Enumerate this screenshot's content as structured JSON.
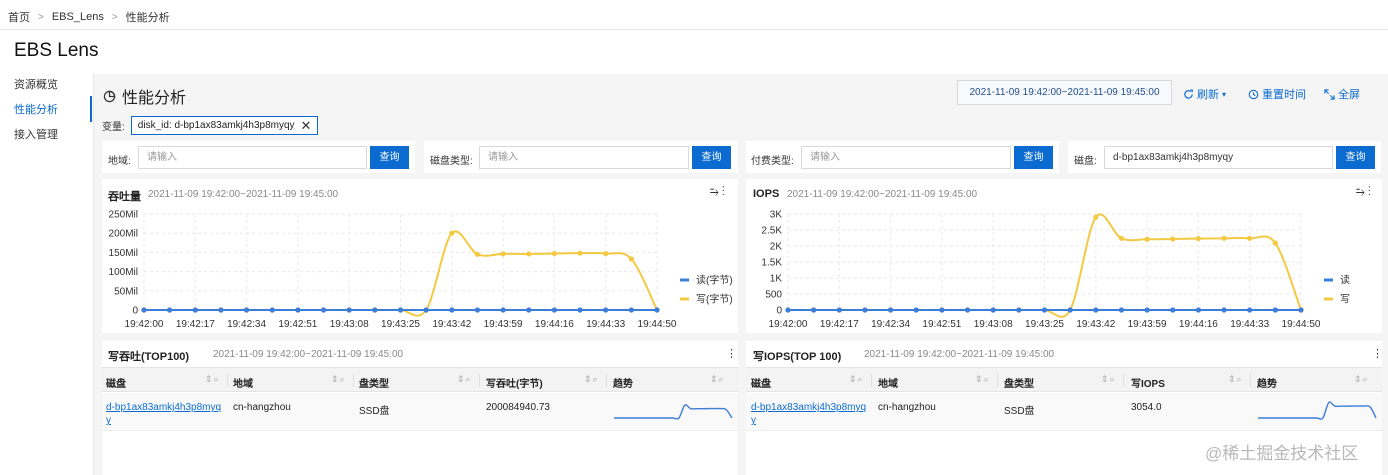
{
  "breadcrumb": {
    "home": "首页",
    "app": "EBS_Lens",
    "current": "性能分析"
  },
  "app_title": "EBS Lens",
  "sidebar": {
    "items": [
      {
        "label": "资源概览",
        "active": false
      },
      {
        "label": "性能分析",
        "active": true
      },
      {
        "label": "接入管理",
        "active": false
      }
    ]
  },
  "page": {
    "title": "性能分析",
    "time_range": "2021-11-09 19:42:00~2021-11-09 19:45:00",
    "refresh": "刷新",
    "reset": "重置时间",
    "fullscreen": "全屏"
  },
  "variables": {
    "label": "变量:",
    "tag": "disk_id: d-bp1ax83amkj4h3p8myqy"
  },
  "filters": [
    {
      "label": "地域:",
      "placeholder": "请输入",
      "value": "",
      "button": "查询"
    },
    {
      "label": "磁盘类型:",
      "placeholder": "请输入",
      "value": "",
      "button": "查询"
    },
    {
      "label": "付费类型:",
      "placeholder": "请输入",
      "value": "",
      "button": "查询"
    },
    {
      "label": "磁盘:",
      "placeholder": "",
      "value": "d-bp1ax83amkj4h3p8myqy",
      "button": "查询"
    }
  ],
  "colors": {
    "accent": "#0b6bd1",
    "read": "#3b7dd8",
    "write": "#f4c942"
  },
  "chart_data": [
    {
      "type": "line",
      "title": "吞吐量",
      "subtitle": "2021-11-09 19:42:00~2021-11-09 19:45:00",
      "x": [
        "19:42:00",
        "19:42:08",
        "19:42:17",
        "19:42:25",
        "19:42:34",
        "19:42:42",
        "19:42:51",
        "19:42:59",
        "19:43:08",
        "19:43:16",
        "19:43:25",
        "19:43:33",
        "19:43:42",
        "19:43:50",
        "19:43:59",
        "19:44:07",
        "19:44:16",
        "19:44:24",
        "19:44:33",
        "19:44:41",
        "19:44:50"
      ],
      "xticks": [
        "19:42:00",
        "19:42:17",
        "19:42:34",
        "19:42:51",
        "19:43:08",
        "19:43:25",
        "19:43:42",
        "19:43:59",
        "19:44:16",
        "19:44:33",
        "19:44:50"
      ],
      "yticks": [
        "0",
        "50Mil",
        "100Mil",
        "150Mil",
        "200Mil",
        "250Mil"
      ],
      "ylim": [
        0,
        250
      ],
      "legend_position": "right",
      "series": [
        {
          "name": "读(字节)",
          "values": [
            0,
            0,
            0,
            0,
            0,
            0,
            0,
            0,
            0,
            0,
            0,
            0,
            0,
            0,
            0,
            0,
            0,
            0,
            0,
            0,
            0
          ]
        },
        {
          "name": "写(字节)",
          "values": [
            0,
            0,
            0,
            0,
            0,
            0,
            0,
            0,
            0,
            0,
            0,
            0,
            200,
            145,
            146,
            146,
            147,
            148,
            147,
            133,
            0
          ]
        }
      ]
    },
    {
      "type": "line",
      "title": "IOPS",
      "subtitle": "2021-11-09 19:42:00~2021-11-09 19:45:00",
      "x": [
        "19:42:00",
        "19:42:08",
        "19:42:17",
        "19:42:25",
        "19:42:34",
        "19:42:42",
        "19:42:51",
        "19:42:59",
        "19:43:08",
        "19:43:16",
        "19:43:25",
        "19:43:33",
        "19:43:42",
        "19:43:50",
        "19:43:59",
        "19:44:07",
        "19:44:16",
        "19:44:24",
        "19:44:33",
        "19:44:41",
        "19:44:50"
      ],
      "xticks": [
        "19:42:00",
        "19:42:17",
        "19:42:34",
        "19:42:51",
        "19:43:08",
        "19:43:25",
        "19:43:42",
        "19:43:59",
        "19:44:16",
        "19:44:33",
        "19:44:50"
      ],
      "yticks": [
        "0",
        "500",
        "1K",
        "1.5K",
        "2K",
        "2.5K",
        "3K"
      ],
      "ylim": [
        0,
        3000
      ],
      "legend_position": "right",
      "series": [
        {
          "name": "读",
          "values": [
            0,
            0,
            0,
            0,
            0,
            0,
            0,
            0,
            0,
            0,
            0,
            0,
            0,
            0,
            0,
            0,
            0,
            0,
            0,
            0,
            0
          ]
        },
        {
          "name": "写",
          "values": [
            0,
            0,
            0,
            0,
            0,
            0,
            0,
            0,
            0,
            0,
            0,
            0,
            2900,
            2240,
            2210,
            2220,
            2230,
            2240,
            2240,
            2090,
            0
          ]
        }
      ]
    }
  ],
  "tables": [
    {
      "title": "写吞吐(TOP100)",
      "subtitle": "2021-11-09 19:42:00~2021-11-09 19:45:00",
      "columns": [
        "磁盘",
        "地域",
        "盘类型",
        "写吞吐(字节)",
        "趋势"
      ],
      "rows": [
        {
          "disk": "d-bp1ax83amkj4h3p8myqy",
          "disk_line1": "d-bp1ax83amkj4h3p8myq",
          "disk_line2": "y",
          "region": "cn-hangzhou",
          "type": "SSD盘",
          "value": "200084940.73"
        }
      ]
    },
    {
      "title": "写IOPS(TOP 100)",
      "subtitle": "2021-11-09 19:42:00~2021-11-09 19:45:00",
      "columns": [
        "磁盘",
        "地域",
        "盘类型",
        "写IOPS",
        "趋势"
      ],
      "rows": [
        {
          "disk": "d-bp1ax83amkj4h3p8myqy",
          "disk_line1": "d-bp1ax83amkj4h3p8myq",
          "disk_line2": "y",
          "region": "cn-hangzhou",
          "type": "SSD盘",
          "value": "3054.0"
        }
      ]
    }
  ],
  "watermark": "@稀土掘金技术社区"
}
